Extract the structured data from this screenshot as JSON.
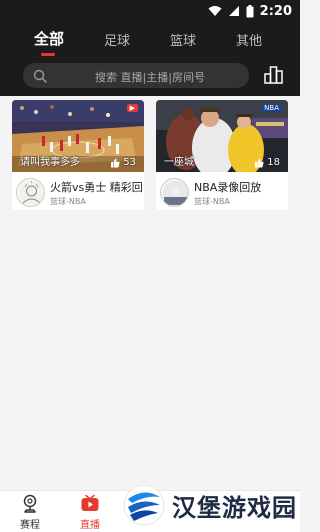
{
  "status_bar": {
    "time": "2:20"
  },
  "tabs": [
    {
      "label": "全部",
      "active": true
    },
    {
      "label": "足球",
      "active": false
    },
    {
      "label": "篮球",
      "active": false
    },
    {
      "label": "其他",
      "active": false
    }
  ],
  "search": {
    "placeholder": "搜索 直播|主播|房间号"
  },
  "cards": [
    {
      "overlay_text": "请叫我事多多",
      "likes": "53",
      "title": "火箭vs勇士 精彩回放",
      "subtitle": "篮球-NBA"
    },
    {
      "overlay_text": "一座城",
      "likes": "18",
      "title": "NBA录像回放",
      "subtitle": "篮球-NBA",
      "thumb_badge": "NBA"
    }
  ],
  "bottom_tabs": [
    {
      "label": "赛程",
      "active": false,
      "icon": "trophy-icon"
    },
    {
      "label": "直播",
      "active": true,
      "icon": "play-tv-icon"
    }
  ],
  "watermark": {
    "text": "汉堡游戏园"
  },
  "colors": {
    "header_bg": "#1b1b1b",
    "accent": "#e43a2f",
    "page_bg": "#f4f4f4"
  }
}
